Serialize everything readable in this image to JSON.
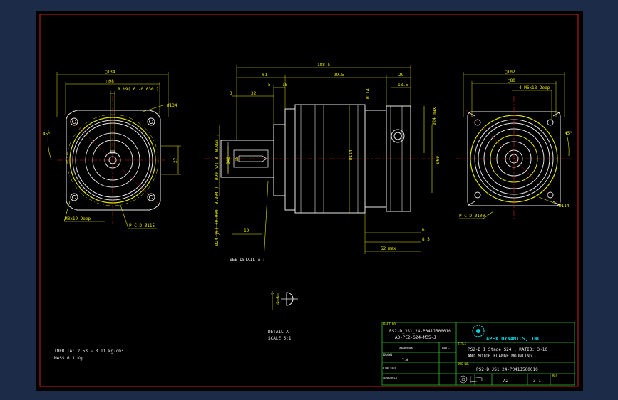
{
  "drawing": {
    "front_left": {
      "dim_square_outer": "□134",
      "dim_square_inner": "□98",
      "dim_keyway": "8 h9( 0 -0.036 )",
      "dim_flange_dia": "Ø134",
      "dim_angle": "45°",
      "dim_27": "27",
      "dim_bolt_holes": "M8x19 Deep",
      "dim_pcd": "P.C.D Ø115"
    },
    "side_view": {
      "dim_total": "188.5",
      "dim_61": "61",
      "dim_99_5": "99.5",
      "dim_29": "29",
      "dim_3": "3",
      "dim_32": "32",
      "dim_5": "5",
      "dim_16": "16",
      "dim_18_5": "18.5",
      "dim_114_top": "Ø114",
      "dim_114_mid": "Ø114",
      "dim_24_max": "Ø24 max",
      "dim_90_h7": "Ø90 h7( 0 -0.035 )",
      "dim_40": "Ø40",
      "dim_18": "18",
      "dim_24_j6": "Ø24 j6( +0.009 -0.004 )",
      "dim_19": "19",
      "dim_60": "Ø60",
      "dim_6": "6",
      "dim_8_5": "8.5",
      "dim_52_max": "52 max",
      "see_detail": "SEE DETAIL A"
    },
    "front_right": {
      "dim_square_outer": "□102",
      "dim_square_inner": "□80",
      "dim_bolt_holes": "4-M6x18 Deep",
      "dim_angle": "45°",
      "dim_flange_dia": "Ø114",
      "dim_pcd": "P.C.D Ø100"
    },
    "detail": {
      "dim_2": "2",
      "dim_2_5": "2.5",
      "title": "DETAIL A",
      "scale": "SCALE 5:1"
    },
    "properties": {
      "inertia": "INERTIA: 2.53 ~ 3.11 kg·cm²",
      "mass": "MASS 6.1  Kg"
    }
  },
  "title_block": {
    "part_no_label": "PART NO.",
    "part_no_line1": "PS2-D_JS1_24-P041J500010",
    "part_no_line2": "AD-PE2-S24-M35-J",
    "company": "APEX DYNAMICS, INC.",
    "approval_label": "APPROVAL",
    "date_label": "DATE",
    "title_label": "TITLE",
    "title_line1": "PS2-D_1 Stage_S24 , RATIO: 3~10",
    "title_line2": "AND MOTOR FLANGE MOUNTING",
    "drawn_label": "DRAWN",
    "drawn_value": "Y.W",
    "dwg_no_label": "DWG NO.",
    "dwg_no_value": "PS2-D_JS1_24-P041J500010",
    "checked_label": "CHECKED",
    "approved_label": "APPROVED",
    "size_value": "A2",
    "scale_value": "3:1",
    "rev_label": "REV"
  }
}
